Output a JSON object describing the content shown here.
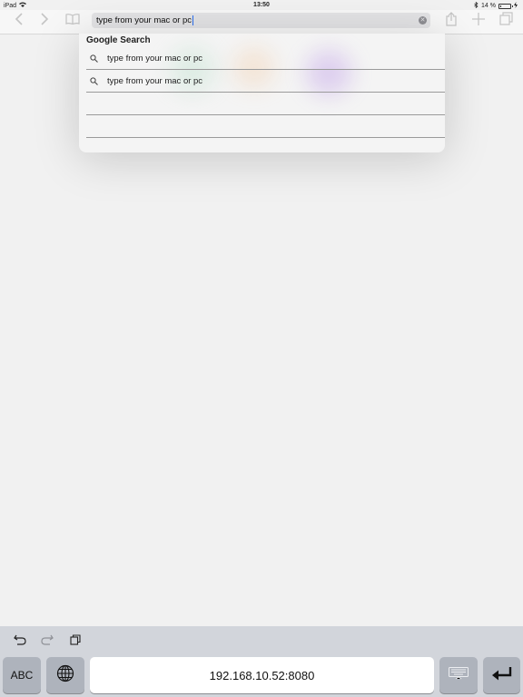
{
  "status": {
    "device": "iPad",
    "time": "13:50",
    "battery_percent": "14 %",
    "battery_level": 0.14
  },
  "toolbar": {
    "url_text": "type from your mac or pc"
  },
  "suggestions": {
    "header": "Google Search",
    "items": [
      {
        "text": "type from your mac or pc"
      },
      {
        "text": "type from your mac or pc"
      },
      {
        "text": ""
      },
      {
        "text": ""
      }
    ]
  },
  "keyboard": {
    "abc_label": "ABC",
    "address": "192.168.10.52:8080"
  },
  "icons": {
    "back": "chevron-left-icon",
    "forward": "chevron-right-icon",
    "bookmarks": "book-icon",
    "share": "share-icon",
    "new_tab": "plus-icon",
    "tabs": "tabs-icon",
    "search": "magnifier-icon",
    "undo": "undo-icon",
    "redo": "redo-icon",
    "paste": "clipboard-icon",
    "globe": "globe-icon",
    "keyboard": "keyboard-icon",
    "return": "return-icon"
  }
}
